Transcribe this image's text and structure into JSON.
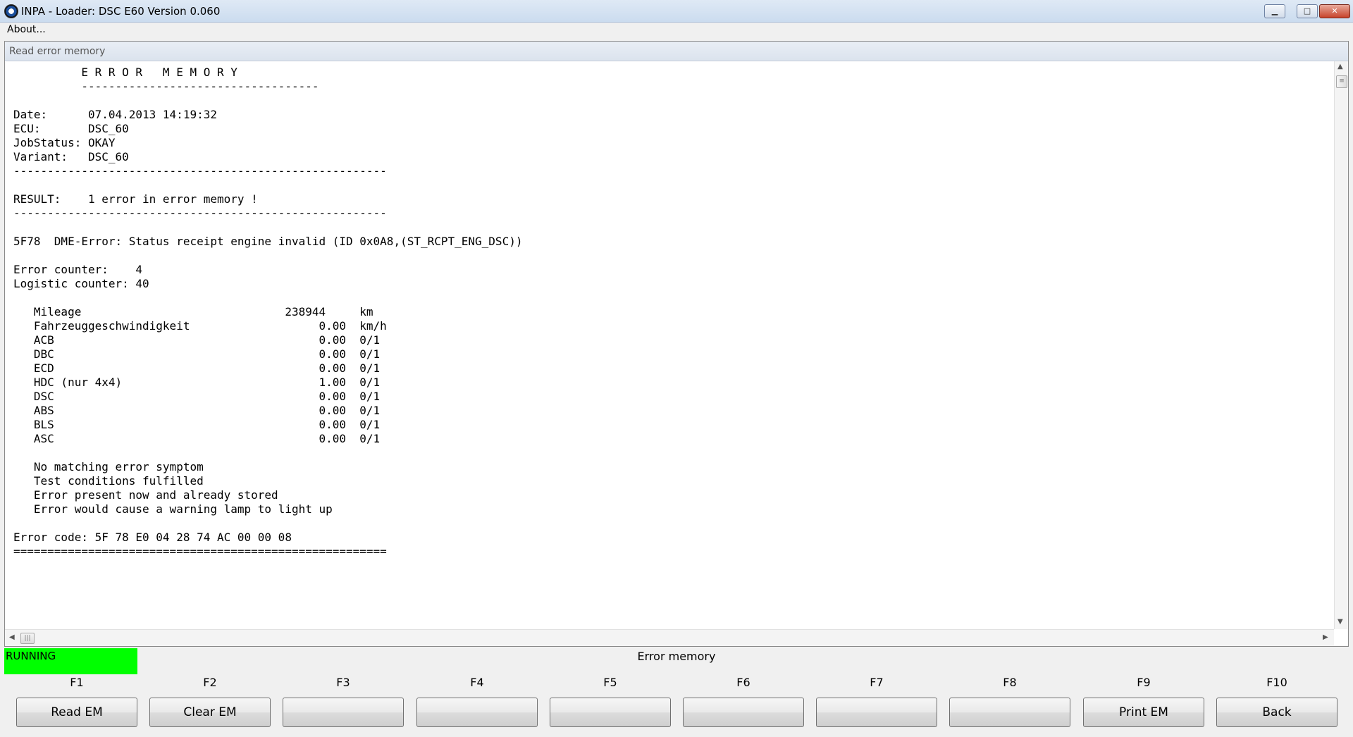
{
  "window": {
    "title": "INPA - Loader:  DSC E60 Version 0.060",
    "min_glyph": "▁",
    "max_glyph": "□",
    "close_glyph": "✕"
  },
  "menu": {
    "about": "About..."
  },
  "panel": {
    "header": "Read error memory"
  },
  "output": {
    "lines": [
      "          E R R O R   M E M O R Y",
      "          -----------------------------------",
      "",
      "Date:      07.04.2013 14:19:32",
      "ECU:       DSC_60",
      "JobStatus: OKAY",
      "Variant:   DSC_60",
      "-------------------------------------------------------",
      "",
      "RESULT:    1 error in error memory !",
      "-------------------------------------------------------",
      "",
      "5F78  DME-Error: Status receipt engine invalid (ID 0x0A8,(ST_RCPT_ENG_DSC))",
      "",
      "Error counter:    4",
      "Logistic counter: 40",
      "",
      "   Mileage                              238944     km",
      "   Fahrzeuggeschwindigkeit                   0.00  km/h",
      "   ACB                                       0.00  0/1",
      "   DBC                                       0.00  0/1",
      "   ECD                                       0.00  0/1",
      "   HDC (nur 4x4)                             1.00  0/1",
      "   DSC                                       0.00  0/1",
      "   ABS                                       0.00  0/1",
      "   BLS                                       0.00  0/1",
      "   ASC                                       0.00  0/1",
      "",
      "   No matching error symptom",
      "   Test conditions fulfilled",
      "   Error present now and already stored",
      "   Error would cause a warning lamp to light up",
      "",
      "Error code: 5F 78 E0 04 28 74 AC 00 00 08",
      "======================================================="
    ]
  },
  "status": {
    "state": "RUNNING",
    "state_color": "#00ff00",
    "title": "Error memory"
  },
  "function_keys": [
    {
      "key": "F1",
      "label": "Read EM"
    },
    {
      "key": "F2",
      "label": "Clear EM"
    },
    {
      "key": "F3",
      "label": ""
    },
    {
      "key": "F4",
      "label": ""
    },
    {
      "key": "F5",
      "label": ""
    },
    {
      "key": "F6",
      "label": ""
    },
    {
      "key": "F7",
      "label": ""
    },
    {
      "key": "F8",
      "label": ""
    },
    {
      "key": "F9",
      "label": "Print EM"
    },
    {
      "key": "F10",
      "label": "Back"
    }
  ]
}
